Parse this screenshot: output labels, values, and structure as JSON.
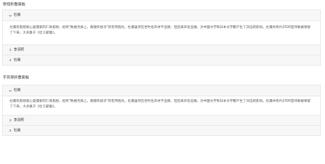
{
  "sections": [
    {
      "title": "常规折叠面板",
      "panels": [
        {
          "header": "杜甫",
          "expanded": true,
          "content": "杜甫的思想核心是儒家的仁政思想，他有\"致君尧舜上，再使风俗淳\"的宏伟抱负。杜甫虽然在世时名声并不显赫，但后来声名远播，对中国文学和日本文学都产生了深远的影响。杜甫共有约1500首诗歌被保留了下来，大多集于《杜工部集》。"
        },
        {
          "header": "李清照",
          "expanded": false
        },
        {
          "header": "杜甫",
          "expanded": false
        }
      ]
    },
    {
      "title": "手风琴折叠面板",
      "panels": [
        {
          "header": "杜甫",
          "expanded": true,
          "content": "杜甫的思想核心是儒家的仁政思想，他有\"致君尧舜上，再使风俗淳\"的宏伟抱负。杜甫虽然在世时名声并不显赫，但后来声名远播，对中国文学和日本文学都产生了深远的影响。杜甫共有约1500首诗歌被保留了下来，大多集于《杜工部集》。"
        },
        {
          "header": "李清照",
          "expanded": false
        },
        {
          "header": "杜甫",
          "expanded": false
        }
      ]
    }
  ],
  "icons": {
    "collapsed": "chevron-right-icon",
    "expanded": "chevron-down-icon"
  }
}
